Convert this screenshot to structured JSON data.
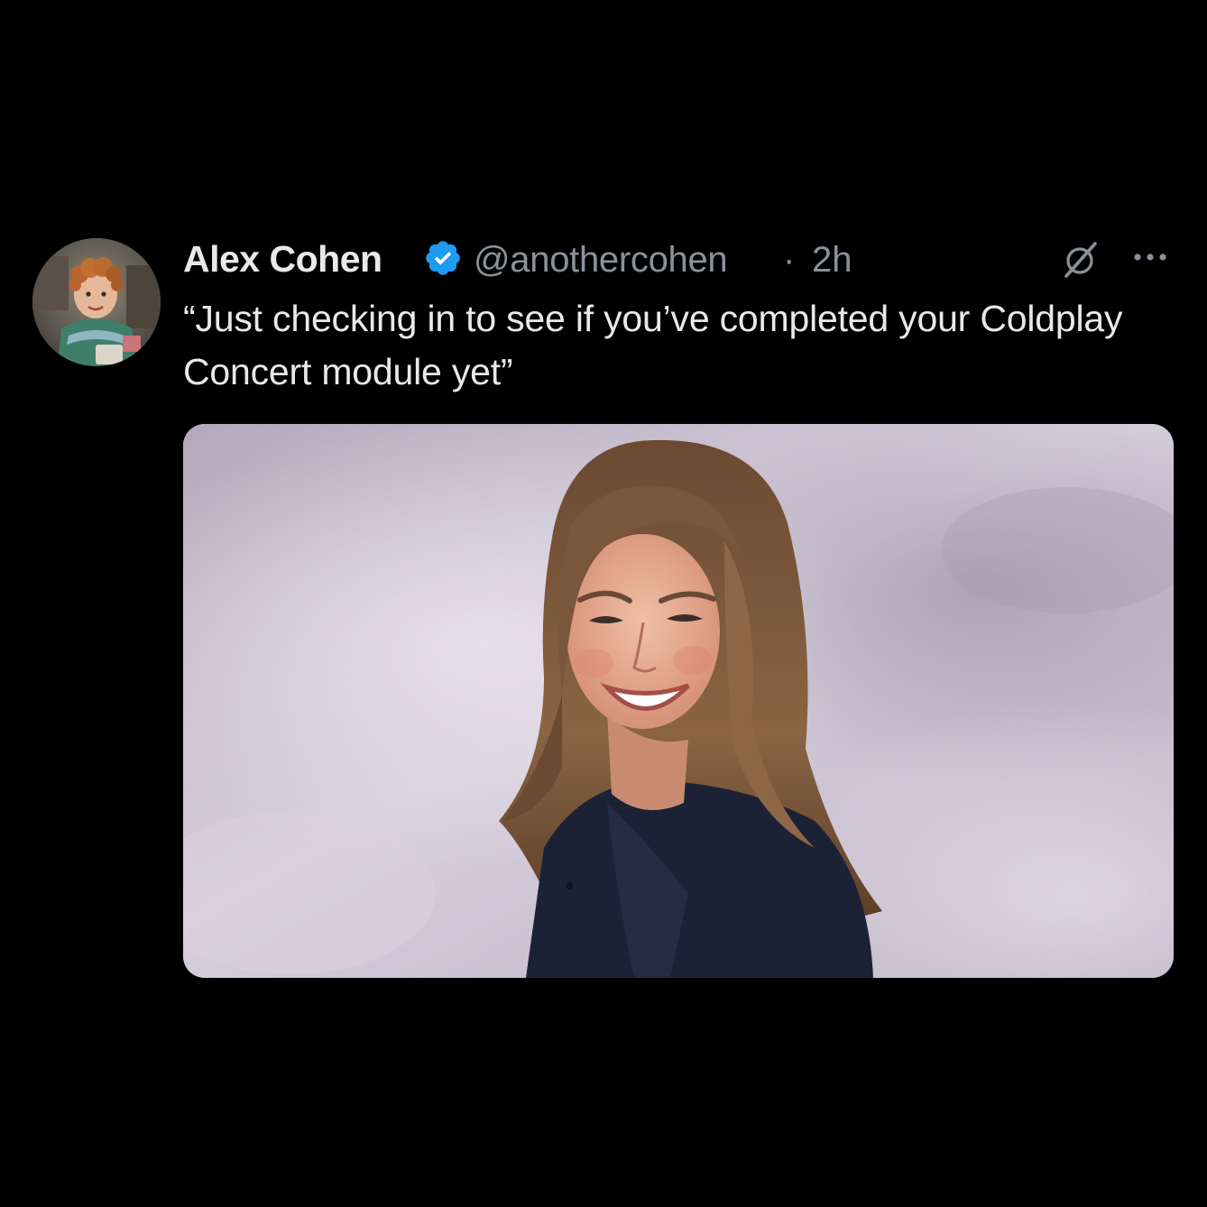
{
  "tweet": {
    "author": {
      "display_name": "Alex Cohen",
      "handle": "@anothercohen",
      "verified": true,
      "avatar_icon": "child-photo-avatar"
    },
    "separator": "·",
    "timestamp": "2h",
    "text": "“Just checking in to see if you’ve completed your Coldplay Concert module yet”",
    "actions": {
      "grok_icon": "grok-icon",
      "more_icon": "more-icon"
    },
    "media": {
      "description_icon": "photo"
    }
  },
  "colors": {
    "background": "#000000",
    "primary_text": "#e7e9ea",
    "secondary_text": "#8b9198",
    "verified_badge": "#1d9bf0"
  }
}
